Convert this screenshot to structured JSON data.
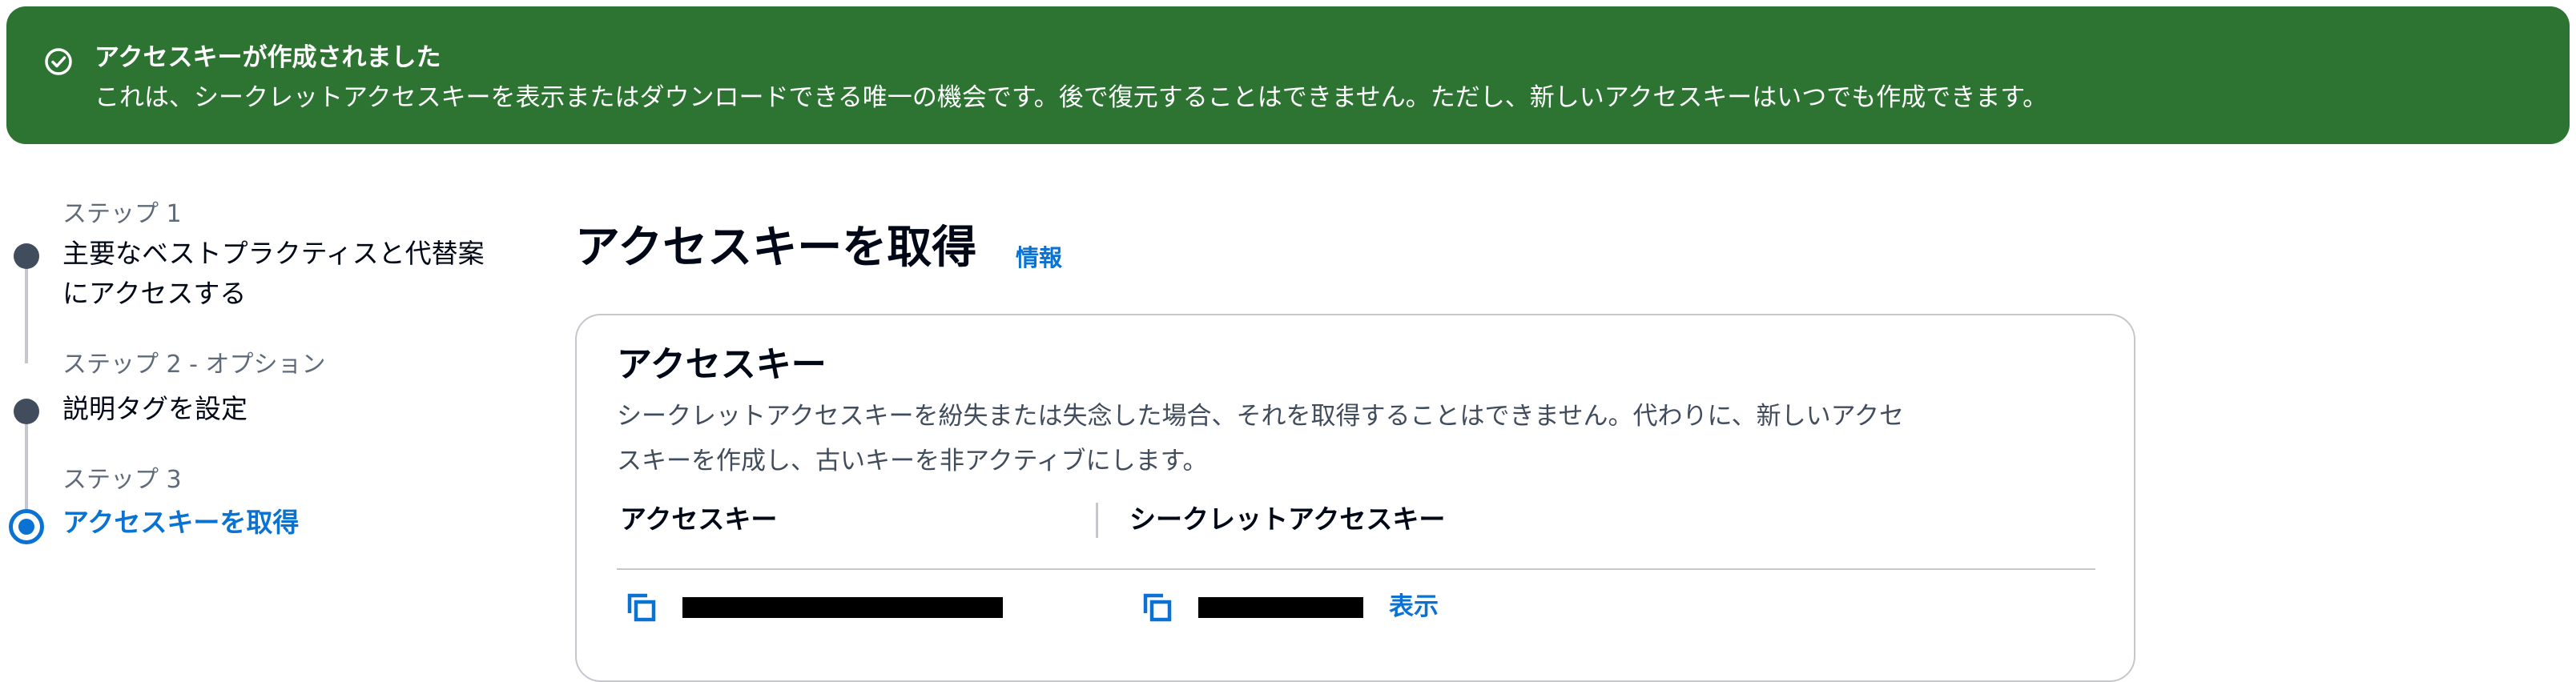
{
  "flash": {
    "icon": "check-circle-icon",
    "color": "#2d7433",
    "title": "アクセスキーが作成されました",
    "message": "これは、シークレットアクセスキーを表示またはダウンロードできる唯一の機会です。後で復元することはできません。ただし、新しいアクセスキーはいつでも作成できます。"
  },
  "steps": [
    {
      "caption": "ステップ 1",
      "title_lines": [
        "主要なベストプラクティスと代替案",
        "にアクセスする"
      ],
      "state": "completed"
    },
    {
      "caption": "ステップ 2 - オプション",
      "title": "説明タグを設定",
      "state": "completed"
    },
    {
      "caption": "ステップ 3",
      "title": "アクセスキーを取得",
      "state": "active"
    }
  ],
  "page": {
    "title": "アクセスキーを取得",
    "info_link": "情報"
  },
  "access_key_panel": {
    "title": "アクセスキー",
    "description_lines": [
      "シークレットアクセスキーを紛失または失念した場合、それを取得することはできません。代わりに、新しいアクセ",
      "スキーを作成し、古いキーを非アクティブにします。"
    ],
    "columns": [
      "アクセスキー",
      "シークレットアクセスキー"
    ],
    "row": {
      "access_key": {
        "copy_icon": "copy-icon",
        "value": "[redacted]"
      },
      "secret_key": {
        "copy_icon": "copy-icon",
        "value": "[redacted]",
        "show_link": "表示"
      }
    }
  },
  "colors": {
    "accent": "#0972d3",
    "success": "#2d7433",
    "text": "#000716",
    "muted": "#5f6b7a",
    "border": "#c6c6cd"
  }
}
